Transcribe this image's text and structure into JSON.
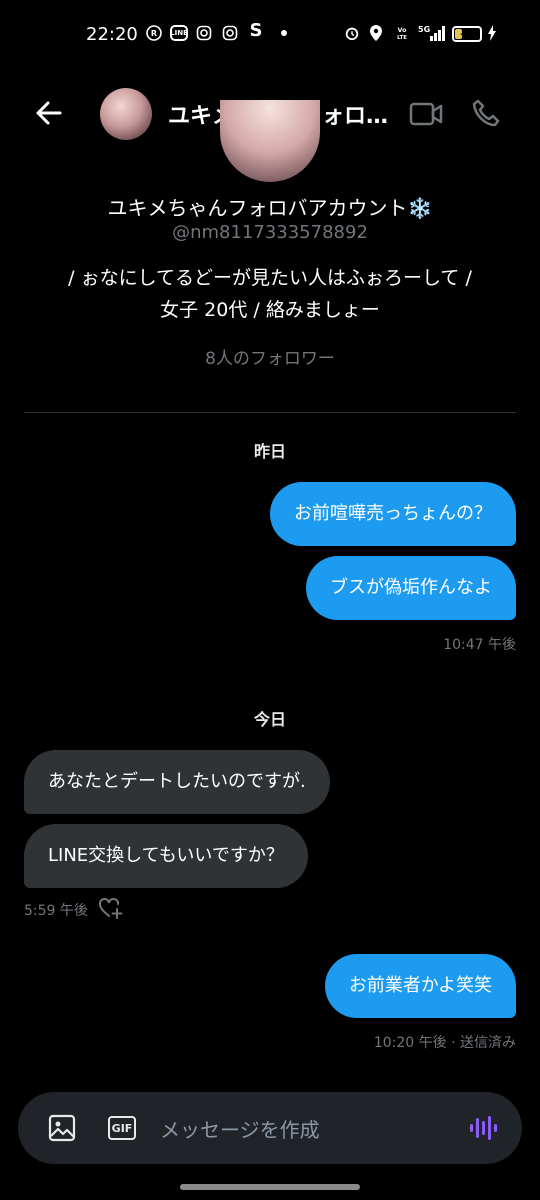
{
  "status_bar": {
    "time": "22:20",
    "app_icons": [
      "rakuten-icon",
      "line-icon",
      "instagram-icon",
      "instagram-icon",
      "s-icon",
      "dot-icon"
    ],
    "s_glyph": "S",
    "line_glyph": "LINE",
    "battery": "31",
    "battery_level": 0.31,
    "network": "5G"
  },
  "header": {
    "title": "ユキメちゃんフォロバアカウント❄️"
  },
  "profile": {
    "name": "ユキメちゃんフォロバアカウント❄️",
    "handle": "@nm8117333578892",
    "bio_line1": "/ ぉなにしてるどーが見たい人はふぉろーして /",
    "bio_line2": "女子 20代 / 絡みましょー",
    "followers": "8人のフォロワー"
  },
  "conversation": {
    "day1_label": "昨日",
    "day1_messages": [
      {
        "text": "お前喧嘩売っちょんの？",
        "direction": "out"
      },
      {
        "text": "ブスが偽垢作んなよ",
        "direction": "out"
      }
    ],
    "day1_time": "10:47 午後",
    "day2_label": "今日",
    "day2_incoming": [
      {
        "text": "あなたとデートしたいのですが.",
        "direction": "in"
      },
      {
        "text": "LINE交換してもいいですか？",
        "direction": "in"
      }
    ],
    "day2_incoming_time": "5:59 午後",
    "day2_outgoing": [
      {
        "text": "お前業者かよ笑笑",
        "direction": "out"
      }
    ],
    "day2_outgoing_time": "10:20 午後 · 送信済み"
  },
  "composer": {
    "placeholder": "メッセージを作成",
    "gif_label": "GIF"
  },
  "colors": {
    "accent": "#1d9bf0",
    "incoming_bubble": "#2f3336",
    "background": "#000000",
    "voice_accent": "#8b5cf6"
  }
}
